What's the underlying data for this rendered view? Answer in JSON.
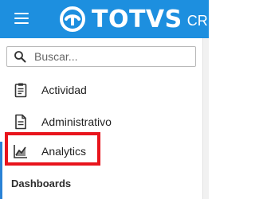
{
  "header": {
    "brand": "TOTVS",
    "product": "CRM"
  },
  "search": {
    "placeholder": "Buscar..."
  },
  "nav": {
    "items": [
      {
        "label": "Actividad",
        "icon": "clipboard-icon"
      },
      {
        "label": "Administrativo",
        "icon": "document-icon"
      },
      {
        "label": "Analytics",
        "icon": "chart-line-icon"
      }
    ],
    "highlighted": "Analytics"
  },
  "section": {
    "title": "Dashboards"
  },
  "colors": {
    "topbar": "#1d8fdf",
    "highlight": "#e8141c",
    "accent_strip": "#2a82d6"
  }
}
